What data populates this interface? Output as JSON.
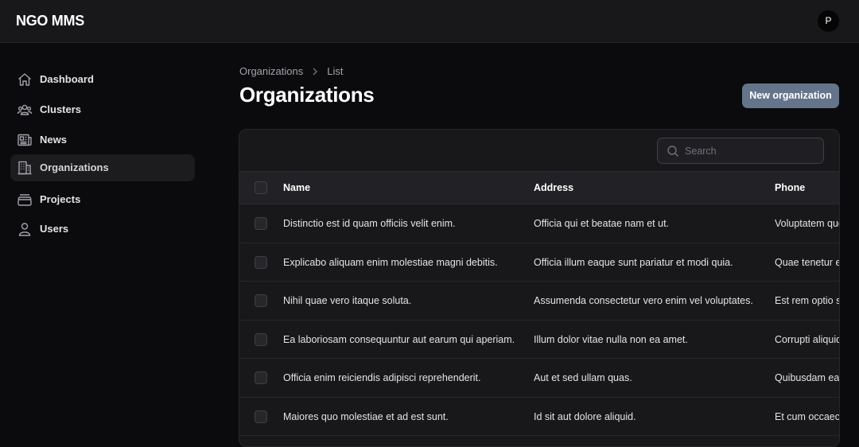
{
  "app": {
    "title": "NGO MMS",
    "user_initial": "P"
  },
  "sidebar": {
    "items": [
      {
        "label": "Dashboard",
        "icon": "home-icon"
      },
      {
        "label": "Clusters",
        "icon": "users-group-icon"
      },
      {
        "label": "News",
        "icon": "newspaper-icon"
      },
      {
        "label": "Organizations",
        "icon": "building-icon",
        "active": true
      },
      {
        "label": "Projects",
        "icon": "archive-box-icon"
      },
      {
        "label": "Users",
        "icon": "user-icon"
      }
    ]
  },
  "breadcrumb": {
    "parent": "Organizations",
    "current": "List"
  },
  "page": {
    "title": "Organizations",
    "new_button": "New organization"
  },
  "search": {
    "placeholder": "Search",
    "value": ""
  },
  "table": {
    "columns": [
      "Name",
      "Address",
      "Phone"
    ],
    "rows": [
      {
        "name": "Distinctio est id quam officiis velit enim.",
        "address": "Officia qui et beatae nam et ut.",
        "phone": "Voluptatem quo"
      },
      {
        "name": "Explicabo aliquam enim molestiae magni debitis.",
        "address": "Officia illum eaque sunt pariatur et modi quia.",
        "phone": "Quae tenetur e"
      },
      {
        "name": "Nihil quae vero itaque soluta.",
        "address": "Assumenda consectetur vero enim vel voluptates.",
        "phone": "Est rem optio s"
      },
      {
        "name": "Ea laboriosam consequuntur aut earum qui aperiam.",
        "address": "Illum dolor vitae nulla non ea amet.",
        "phone": "Corrupti aliquid"
      },
      {
        "name": "Officia enim reiciendis adipisci reprehenderit.",
        "address": "Aut et sed ullam quas.",
        "phone": "Quibusdam ea"
      },
      {
        "name": "Maiores quo molestiae et ad est sunt.",
        "address": "Id sit aut dolore aliquid.",
        "phone": "Et cum occaec"
      }
    ]
  },
  "colors": {
    "accent_button": "#64748b",
    "background": "#0b0b0d",
    "topbar": "#18181b"
  }
}
